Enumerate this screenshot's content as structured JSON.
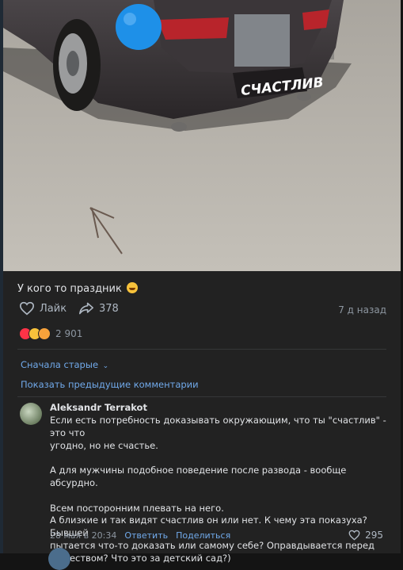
{
  "post": {
    "text": "У кого то праздник",
    "emoji": "grinning-face-emoji",
    "plate_text": "СЧАСТЛИВ",
    "like_label": "Лайк",
    "shares": "378",
    "time_ago": "7 д назад",
    "reactions_count": "2 901",
    "reactions": [
      "heart",
      "laughing",
      "heart-eyes"
    ]
  },
  "comments": {
    "sort_label": "Сначала старые",
    "show_previous": "Показать предыдущие комментарии",
    "items": [
      {
        "author": "Aleksandr Terrakot",
        "lines": [
          "Если есть потребность доказывать окружающим, что ты \"счастлив\" - это что",
          "угодно, но не счастье.",
          "",
          "А для мужчины подобное поведение после развода - вообще абсурдно.",
          "",
          "Всем посторонним плевать на него.",
          "А близкие и так видят счастлив он или нет. К чему эта показуха? Бывшей",
          "пытается что-то доказать или самому себе? Оправдывается перед",
          "обществом? Что это за детский сад?)"
        ],
        "date": "28 мая в 20:34",
        "reply_label": "Ответить",
        "share_label": "Поделиться",
        "likes": "295"
      }
    ]
  },
  "colors": {
    "background": "#141414",
    "card": "#222222",
    "link": "#71aaeb",
    "muted": "#8d96a0"
  }
}
